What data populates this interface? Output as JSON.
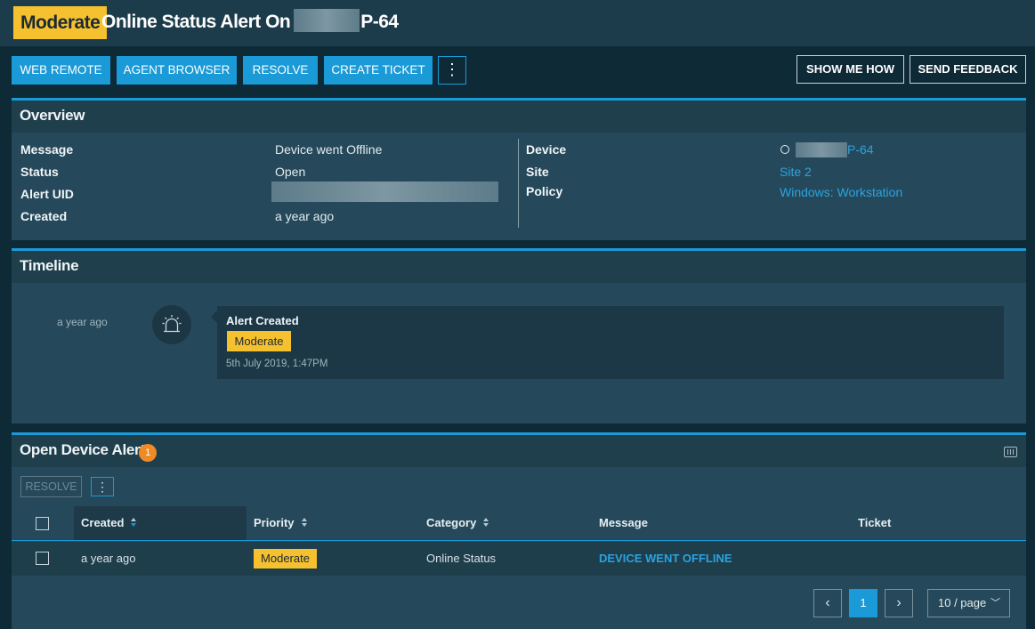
{
  "header": {
    "severity": "Moderate",
    "title_prefix": "Online Status Alert On",
    "device_suffix": "P-64"
  },
  "toolbar": {
    "web_remote": "WEB REMOTE",
    "agent_browser": "AGENT BROWSER",
    "resolve": "RESOLVE",
    "create_ticket": "CREATE TICKET",
    "more": "⋮",
    "show_me_how": "SHOW ME HOW",
    "send_feedback": "SEND FEEDBACK"
  },
  "overview": {
    "title": "Overview",
    "message_label": "Message",
    "message_value": "Device went Offline",
    "status_label": "Status",
    "status_value": "Open",
    "uid_label": "Alert UID",
    "created_label": "Created",
    "created_value": "a year ago",
    "device_label": "Device",
    "device_suffix": "P-64",
    "site_label": "Site",
    "site_value": "Site 2",
    "policy_label": "Policy",
    "policy_value": "Windows: Workstation"
  },
  "timeline": {
    "title": "Timeline",
    "event_time": "a year ago",
    "event_title": "Alert Created",
    "event_priority": "Moderate",
    "event_date": "5th July 2019, 1:47PM"
  },
  "open_alerts": {
    "title": "Open Device Alerts",
    "count": "1",
    "resolve": "RESOLVE",
    "more": "⋮",
    "columns": {
      "created": "Created",
      "priority": "Priority",
      "category": "Category",
      "message": "Message",
      "ticket": "Ticket"
    },
    "rows": [
      {
        "created": "a year ago",
        "priority": "Moderate",
        "category": "Online Status",
        "message": "DEVICE WENT OFFLINE",
        "ticket": ""
      }
    ],
    "pagination": {
      "current_page": "1",
      "page_size": "10 / page"
    }
  },
  "colors": {
    "accent": "#1a9ad6",
    "moderate": "#f6c12f",
    "badge": "#f08a24"
  }
}
